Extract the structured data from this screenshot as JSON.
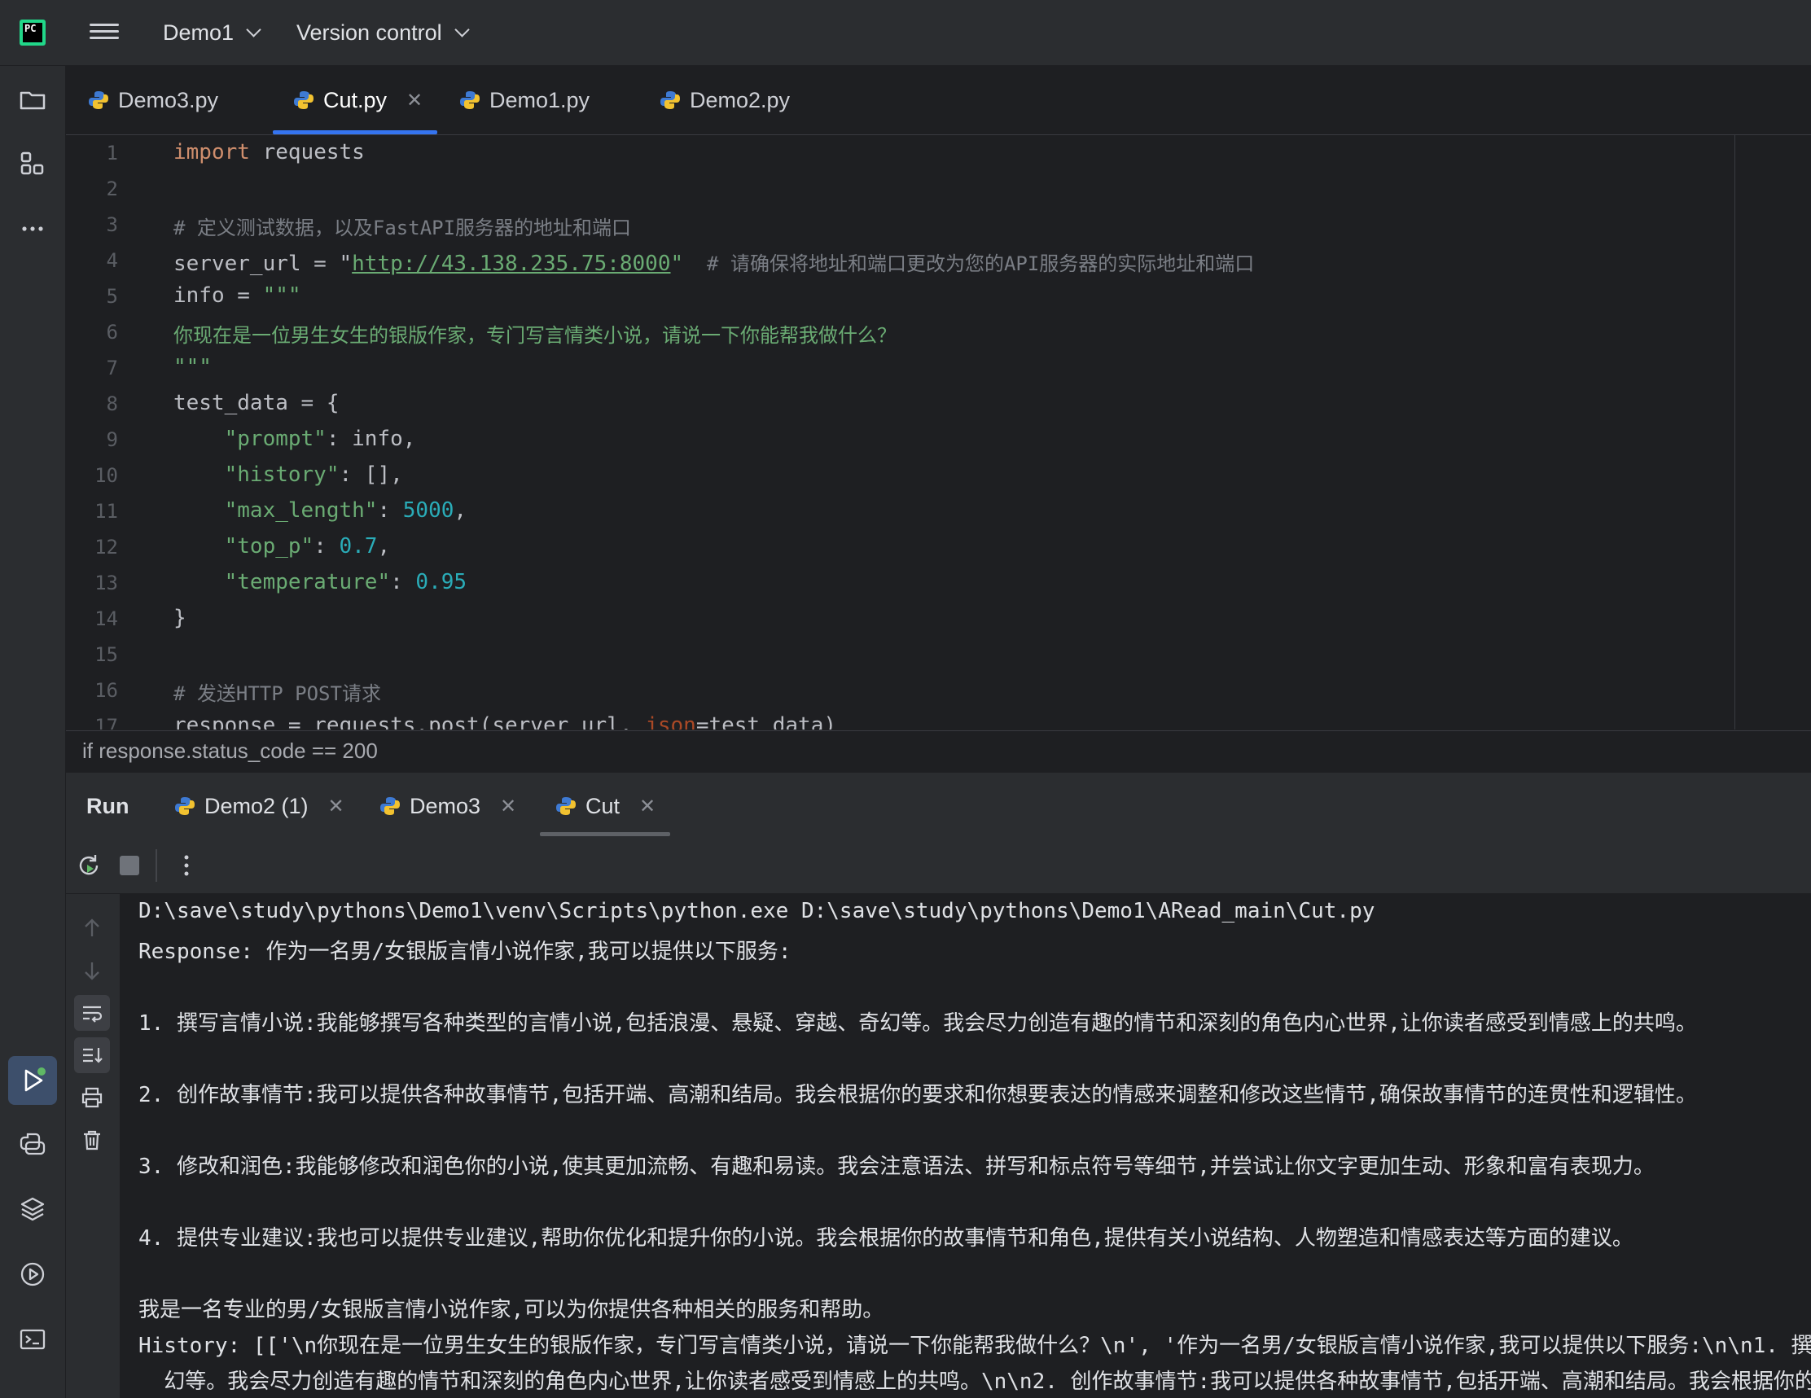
{
  "titlebar": {
    "logo_text": "PC",
    "project": "Demo1",
    "vcs": "Version control"
  },
  "tabs": [
    {
      "label": "Demo3.py"
    },
    {
      "label": "Cut.py"
    },
    {
      "label": "Demo1.py"
    },
    {
      "label": "Demo2.py"
    }
  ],
  "editor": {
    "line_numbers": [
      "1",
      "2",
      "3",
      "4",
      "5",
      "6",
      "7",
      "8",
      "9",
      "10",
      "11",
      "12",
      "13",
      "14",
      "15",
      "16",
      "17"
    ],
    "l1_kw": "import",
    "l1_rest": " requests",
    "l3": "# 定义测试数据，以及FastAPI服务器的地址和端口",
    "l4_a": "server_url = \"",
    "l4_url": "http://43.138.235.75:8000",
    "l4_b": "\"",
    "l4_comment": "  # 请确保将地址和端口更改为您的API服务器的实际地址和端口",
    "l5_a": "info = ",
    "l5_str": "\"\"\"",
    "l6": "你现在是一位男生女生的银版作家，专门写言情类小说，请说一下你能帮我做什么？",
    "l7": "\"\"\"",
    "l8": "test_data = {",
    "l9_key": "    \"prompt\"",
    "l9_rest": ": info,",
    "l10_key": "    \"history\"",
    "l10_rest": ": [],",
    "l11_key": "    \"max_length\"",
    "l11_sep": ": ",
    "l11_num": "5000",
    "l11_end": ",",
    "l12_key": "    \"top_p\"",
    "l12_sep": ": ",
    "l12_num": "0.7",
    "l12_end": ",",
    "l13_key": "    \"temperature\"",
    "l13_sep": ": ",
    "l13_num": "0.95",
    "l14": "}",
    "l16": "# 发送HTTP POST请求",
    "l17_a": "response = requests.post(server_url, ",
    "l17_kw": "json",
    "l17_b": "=test_data)"
  },
  "breadcrumb": "if response.status_code == 200",
  "run": {
    "title": "Run",
    "tabs": [
      {
        "label": "Demo2 (1)"
      },
      {
        "label": "Demo3"
      },
      {
        "label": "Cut"
      }
    ]
  },
  "console": {
    "lines": [
      "D:\\save\\study\\pythons\\Demo1\\venv\\Scripts\\python.exe D:\\save\\study\\pythons\\Demo1\\ARead_main\\Cut.py",
      "Response: 作为一名男/女银版言情小说作家,我可以提供以下服务:",
      "1. 撰写言情小说:我能够撰写各种类型的言情小说,包括浪漫、悬疑、穿越、奇幻等。我会尽力创造有趣的情节和深刻的角色内心世界,让你读者感受到情感上的共鸣。",
      "2. 创作故事情节:我可以提供各种故事情节,包括开端、高潮和结局。我会根据你的要求和你想要表达的情感来调整和修改这些情节,确保故事情节的连贯性和逻辑性。",
      "3. 修改和润色:我能够修改和润色你的小说,使其更加流畅、有趣和易读。我会注意语法、拼写和标点符号等细节,并尝试让你文字更加生动、形象和富有表现力。",
      "4. 提供专业建议:我也可以提供专业建议,帮助你优化和提升你的小说。我会根据你的故事情节和角色,提供有关小说结构、人物塑造和情感表达等方面的建议。",
      "我是一名专业的男/女银版言情小说作家,可以为你提供各种相关的服务和帮助。",
      "History: [['\\n你现在是一位男生女生的银版作家，专门写言情类小说，请说一下你能帮我做什么？\\n', '作为一名男/女银版言情小说作家,我可以提供以下服务:\\n\\n1. 撰",
      "  幻等。我会尽力创造有趣的情节和深刻的角色内心世界,让你读者感受到情感上的共鸣。\\n\\n2. 创作故事情节:我可以提供各种故事情节,包括开端、高潮和结局。我会根据你的"
    ]
  },
  "colors": {
    "accent": "#3574f0",
    "bg": "#1e1f22",
    "panel": "#2b2d30",
    "string": "#6aab73",
    "keyword": "#cf8e6d",
    "number": "#2aacb8",
    "comment": "#7a7e85"
  }
}
